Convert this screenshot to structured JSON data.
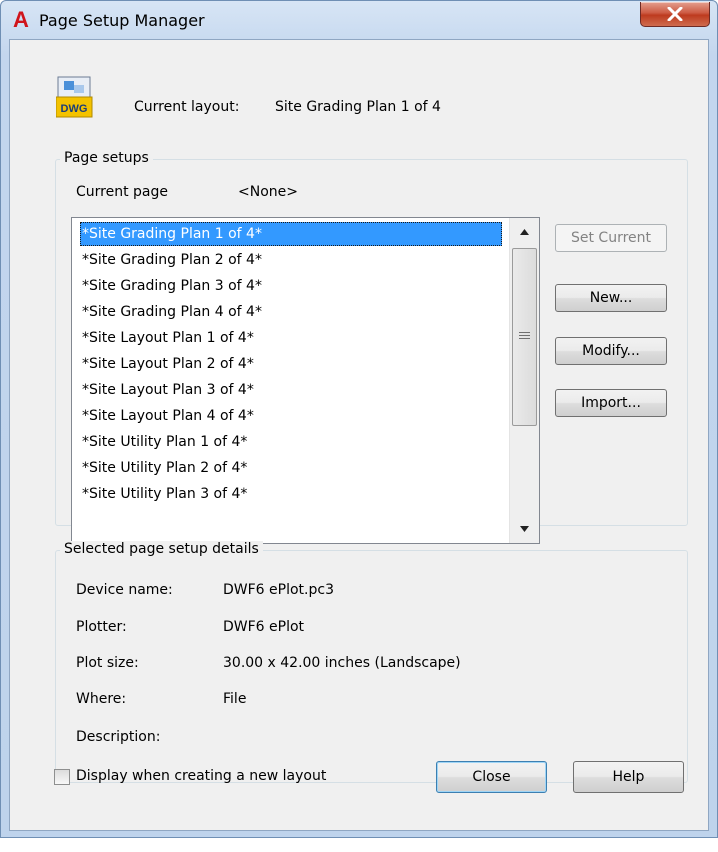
{
  "window": {
    "title": "Page Setup Manager",
    "app_icon": "autocad-icon",
    "close_label": "X"
  },
  "header": {
    "current_layout_label": "Current layout:",
    "current_layout_value": "Site Grading Plan 1 of 4",
    "icon": "dwg-file-icon",
    "icon_text": "DWG"
  },
  "page_setups": {
    "group_label": "Page setups",
    "current_page_label": "Current page",
    "current_page_value": "<None>",
    "items": [
      "*Site Grading Plan 1 of 4*",
      "*Site Grading Plan 2 of 4*",
      "*Site Grading Plan 3 of 4*",
      "*Site Grading Plan 4 of 4*",
      "*Site Layout Plan 1 of 4*",
      "*Site Layout Plan 2 of 4*",
      "*Site Layout Plan 3 of 4*",
      "*Site Layout Plan 4 of 4*",
      "*Site Utility Plan 1 of 4*",
      "*Site Utility Plan 2 of 4*",
      "*Site Utility Plan 3 of 4*"
    ],
    "selected_index": 0
  },
  "buttons": {
    "set_current": "Set Current",
    "new": "New...",
    "modify": "Modify...",
    "import": "Import...",
    "close": "Close",
    "help": "Help"
  },
  "details": {
    "group_label": "Selected page setup details",
    "device_name_label": "Device name:",
    "device_name_value": "DWF6 ePlot.pc3",
    "plotter_label": "Plotter:",
    "plotter_value": "DWF6 ePlot",
    "plot_size_label": "Plot size:",
    "plot_size_value": "30.00 x 42.00 inches (Landscape)",
    "where_label": "Where:",
    "where_value": "File",
    "description_label": "Description:",
    "description_value": ""
  },
  "footer": {
    "display_checkbox_label": "Display when creating a new layout",
    "display_checkbox_checked": false
  },
  "colors": {
    "selection": "#3399ff",
    "close_button": "#c7452c",
    "title_bar": "#c3d6ee"
  }
}
